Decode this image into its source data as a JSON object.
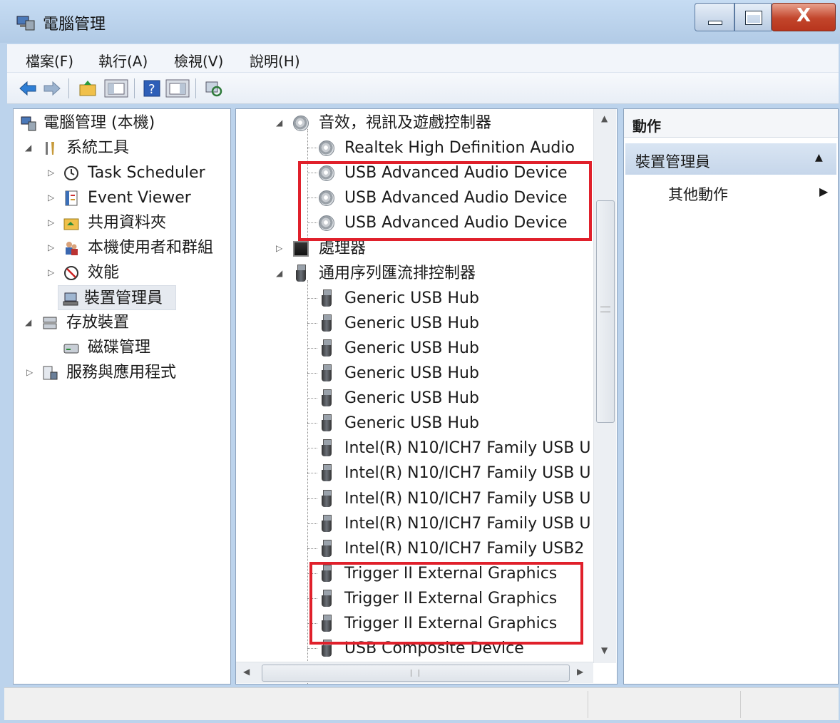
{
  "window": {
    "title": "電腦管理"
  },
  "menu": [
    "檔案(F)",
    "執行(A)",
    "檢視(V)",
    "說明(H)"
  ],
  "toolbar": {
    "icons": [
      "back-arrow-icon",
      "forward-arrow-icon",
      "up-folder-icon",
      "show-hide-tree-icon",
      "help-icon",
      "properties-icon",
      "refresh-icon"
    ]
  },
  "left_tree": [
    {
      "label": "電腦管理 (本機)",
      "icon": "computer-management-icon",
      "expander": "none"
    },
    {
      "label": "系統工具",
      "icon": "tools-icon",
      "expander": "expanded"
    },
    {
      "label": "Task Scheduler",
      "icon": "clock-icon",
      "expander": "collapsed"
    },
    {
      "label": "Event Viewer",
      "icon": "event-viewer-icon",
      "expander": "collapsed"
    },
    {
      "label": "共用資料夾",
      "icon": "shared-folder-icon",
      "expander": "collapsed"
    },
    {
      "label": "本機使用者和群組",
      "icon": "users-icon",
      "expander": "collapsed"
    },
    {
      "label": "效能",
      "icon": "performance-icon",
      "expander": "collapsed"
    },
    {
      "label": "裝置管理員",
      "icon": "device-manager-icon",
      "expander": "none",
      "selected": true
    },
    {
      "label": "存放裝置",
      "icon": "storage-icon",
      "expander": "expanded"
    },
    {
      "label": "磁碟管理",
      "icon": "disk-icon",
      "expander": "none"
    },
    {
      "label": "服務與應用程式",
      "icon": "services-icon",
      "expander": "collapsed"
    }
  ],
  "device_tree": [
    {
      "label": "音效，視訊及遊戲控制器",
      "icon": "speaker",
      "level": 0,
      "expander": "expanded"
    },
    {
      "label": "Realtek High Definition Audio",
      "icon": "speaker",
      "level": 1
    },
    {
      "label": "USB Advanced Audio Device",
      "icon": "speaker",
      "level": 1
    },
    {
      "label": "USB Advanced Audio Device",
      "icon": "speaker",
      "level": 1
    },
    {
      "label": "USB Advanced Audio Device",
      "icon": "speaker",
      "level": 1
    },
    {
      "label": "處理器",
      "icon": "cpu",
      "level": 0,
      "expander": "collapsed"
    },
    {
      "label": "通用序列匯流排控制器",
      "icon": "plug",
      "level": 0,
      "expander": "expanded"
    },
    {
      "label": "Generic USB Hub",
      "icon": "plug",
      "level": 1
    },
    {
      "label": "Generic USB Hub",
      "icon": "plug",
      "level": 1
    },
    {
      "label": "Generic USB Hub",
      "icon": "plug",
      "level": 1
    },
    {
      "label": "Generic USB Hub",
      "icon": "plug",
      "level": 1
    },
    {
      "label": "Generic USB Hub",
      "icon": "plug",
      "level": 1
    },
    {
      "label": "Generic USB Hub",
      "icon": "plug",
      "level": 1
    },
    {
      "label": "Intel(R) N10/ICH7 Family USB U",
      "icon": "plug",
      "level": 1
    },
    {
      "label": "Intel(R) N10/ICH7 Family USB U",
      "icon": "plug",
      "level": 1
    },
    {
      "label": "Intel(R) N10/ICH7 Family USB U",
      "icon": "plug",
      "level": 1
    },
    {
      "label": "Intel(R) N10/ICH7 Family USB U",
      "icon": "plug",
      "level": 1
    },
    {
      "label": "Intel(R) N10/ICH7 Family USB2",
      "icon": "plug",
      "level": 1
    },
    {
      "label": "Trigger II External Graphics",
      "icon": "plug",
      "level": 1
    },
    {
      "label": "Trigger II External Graphics",
      "icon": "plug",
      "level": 1
    },
    {
      "label": "Trigger II External Graphics",
      "icon": "plug",
      "level": 1
    },
    {
      "label": "USB Composite Device",
      "icon": "plug",
      "level": 1
    }
  ],
  "actions": {
    "title": "動作",
    "section": "裝置管理員",
    "more": "其他動作"
  },
  "colors": {
    "highlight": "#e0202b",
    "selection": "#e6eaf0",
    "action_band": "#c6d6ea"
  }
}
